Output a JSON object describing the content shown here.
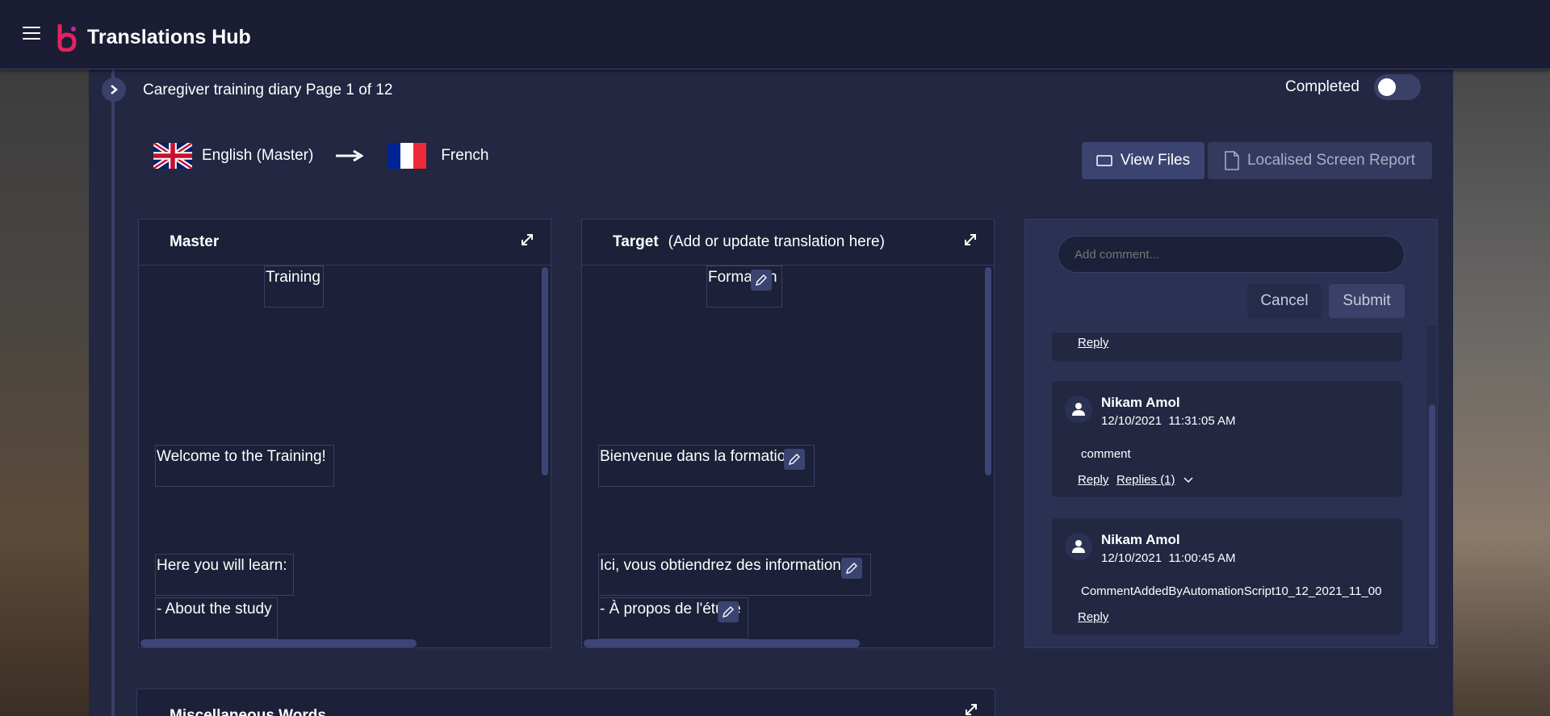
{
  "app": {
    "title": "Translations Hub"
  },
  "page": {
    "title": "Caregiver training diary Page 1 of 12",
    "completed_label": "Completed",
    "completed": false
  },
  "languages": {
    "source": "English (Master)",
    "target": "French"
  },
  "buttons": {
    "view_files": "View Files",
    "report": "Localised Screen Report"
  },
  "master": {
    "title": "Master",
    "items": [
      "Training",
      "Welcome to the Training!",
      "Here you will learn:",
      "- About the study"
    ]
  },
  "target": {
    "title": "Target",
    "subtitle": "(Add or update translation here)",
    "items": [
      "Formation",
      "Bienvenue dans la formation !",
      "Ici, vous obtiendrez des informations :",
      "- À propos de l'étude"
    ]
  },
  "comments": {
    "placeholder": "Add comment...",
    "cancel": "Cancel",
    "submit": "Submit",
    "top_reply": "Reply",
    "list": [
      {
        "author": "Nikam Amol",
        "date": "12/10/2021",
        "time": "11:31:05 AM",
        "text": "comment",
        "reply": "Reply",
        "replies": "Replies (1)"
      },
      {
        "author": "Nikam Amol",
        "date": "12/10/2021",
        "time": "11:00:45 AM",
        "text": "CommentAddedByAutomationScript10_12_2021_11_00",
        "reply": "Reply"
      }
    ]
  },
  "misc": {
    "title": "Miscellaneous Words"
  }
}
